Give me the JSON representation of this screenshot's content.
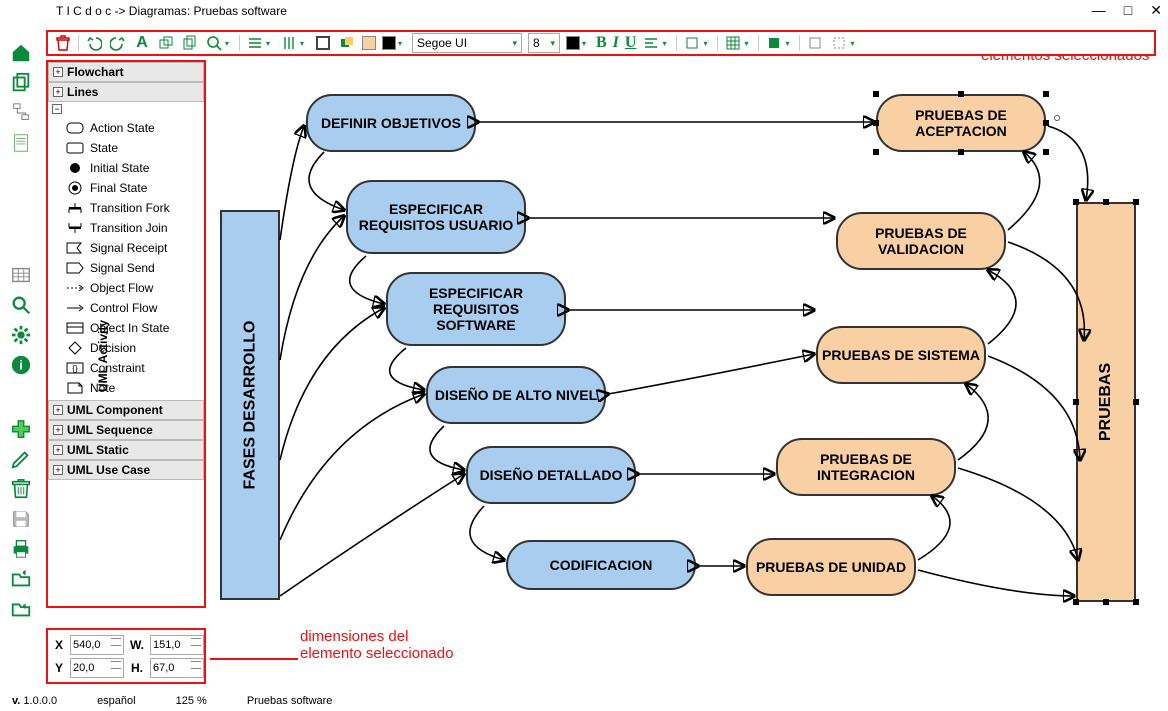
{
  "window": {
    "title": "T I C d o c  -> Diagramas: Pruebas software"
  },
  "winbtns": {
    "min": "—",
    "max": "□",
    "close": "✕"
  },
  "toolbar": {
    "font": "Segoe UI",
    "size": "8"
  },
  "annotations": {
    "top": "cambio propiedades de elementos seleccionados",
    "bottom": "dimensiones del elemento seleccionado"
  },
  "palette": {
    "vlabel": "UML Activity",
    "groups": [
      {
        "label": "Flowchart",
        "expanded": false
      },
      {
        "label": "Lines",
        "expanded": false
      },
      {
        "label": "",
        "expanded": true,
        "items": [
          {
            "icon": "action",
            "label": "Action State"
          },
          {
            "icon": "state",
            "label": "State"
          },
          {
            "icon": "dot",
            "label": "Initial State"
          },
          {
            "icon": "ring",
            "label": "Final State"
          },
          {
            "icon": "fork",
            "label": "Transition Fork"
          },
          {
            "icon": "join",
            "label": "Transition Join"
          },
          {
            "icon": "recv",
            "label": "Signal Receipt"
          },
          {
            "icon": "send",
            "label": "Signal Send"
          },
          {
            "icon": "oflow",
            "label": "Object Flow"
          },
          {
            "icon": "cflow",
            "label": "Control Flow"
          },
          {
            "icon": "ois",
            "label": "Object In State"
          },
          {
            "icon": "dec",
            "label": "Decision"
          },
          {
            "icon": "con",
            "label": "Constraint"
          },
          {
            "icon": "note",
            "label": "Note"
          }
        ]
      },
      {
        "label": "UML Component",
        "expanded": false
      },
      {
        "label": "UML Sequence",
        "expanded": false
      },
      {
        "label": "UML Static",
        "expanded": false
      },
      {
        "label": "UML Use Case",
        "expanded": false
      }
    ]
  },
  "dims": {
    "xlbl": "X",
    "ylbl": "Y",
    "wlbl": "W.",
    "hlbl": "H.",
    "x": "540,0",
    "y": "20,0",
    "w": "151,0",
    "h": "67,0"
  },
  "status": {
    "ver_lbl": "v.",
    "ver": "1.0.0.0",
    "lang": "español",
    "zoom": "125 %",
    "doc": "Pruebas software"
  },
  "diagram": {
    "fases": "FASES DESARROLLO",
    "pruebas": "PRUEBAS",
    "left": [
      "DEFINIR OBJETIVOS",
      "ESPECIFICAR REQUISITOS USUARIO",
      "ESPECIFICAR REQUISITOS SOFTWARE",
      "DISEÑO DE ALTO NIVEL",
      "DISEÑO DETALLADO",
      "CODIFICACION"
    ],
    "right": [
      "PRUEBAS DE ACEPTACION",
      "PRUEBAS DE VALIDACION",
      "PRUEBAS DE SISTEMA",
      "PRUEBAS DE INTEGRACION",
      "PRUEBAS DE UNIDAD"
    ]
  }
}
